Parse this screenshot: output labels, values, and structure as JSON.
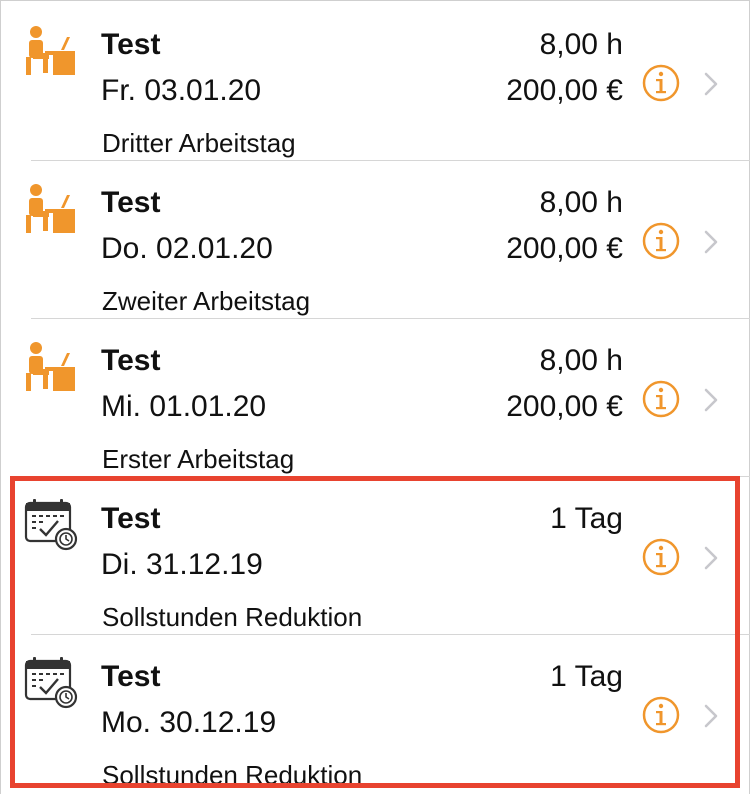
{
  "colors": {
    "accent": "#f0962c",
    "highlight": "#e8432f",
    "chevron": "#c7c7cc"
  },
  "entries": [
    {
      "icon": "worker-at-desk-icon",
      "title": "Test",
      "date": "Fr. 03.01.20",
      "note": "Dritter Arbeitstag",
      "hours": "8,00 h",
      "amount": "200,00 €"
    },
    {
      "icon": "worker-at-desk-icon",
      "title": "Test",
      "date": "Do. 02.01.20",
      "note": "Zweiter Arbeitstag",
      "hours": "8,00 h",
      "amount": "200,00 €"
    },
    {
      "icon": "worker-at-desk-icon",
      "title": "Test",
      "date": "Mi. 01.01.20",
      "note": "Erster Arbeitstag",
      "hours": "8,00 h",
      "amount": "200,00 €"
    },
    {
      "icon": "calendar-check-clock-icon",
      "title": "Test",
      "date": "Di. 31.12.19",
      "note": "Sollstunden Reduktion",
      "hours": "1 Tag",
      "amount": ""
    },
    {
      "icon": "calendar-check-clock-icon",
      "title": "Test",
      "date": "Mo. 30.12.19",
      "note": "Sollstunden Reduktion",
      "hours": "1 Tag",
      "amount": ""
    }
  ]
}
